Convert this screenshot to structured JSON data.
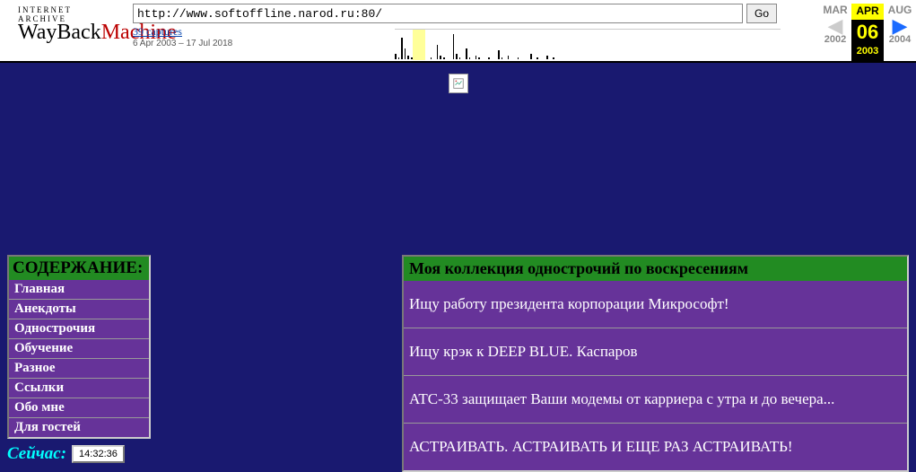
{
  "wayback": {
    "logo_line1": "INTERNET ARCHIVE",
    "logo_word1": "WayBack",
    "logo_word2": "Machine",
    "url": "http://www.softoffline.narod.ru:80/",
    "go_label": "Go",
    "captures_link": "39 captures",
    "captures_range": "6 Apr 2003 – 17 Jul 2018",
    "nav": {
      "prev_month": "MAR",
      "prev_year": "2002",
      "cur_month": "APR",
      "cur_day": "06",
      "cur_year": "2003",
      "next_month": "AUG",
      "next_year": "2004"
    }
  },
  "sidebar": {
    "title": "СОДЕРЖАНИЕ:",
    "items": [
      "Главная",
      "Анекдоты",
      "Однострочия",
      "Обучение",
      "Разное",
      "Ссылки",
      "Обо мне",
      "Для гостей"
    ]
  },
  "clock": {
    "label": "Сейчас:",
    "time": "14:32:36"
  },
  "content": {
    "title": "Моя коллекция однострочий по воскресениям",
    "rows": [
      "Ищу работу президента корпорации Микрософт!",
      "Ищу крэк к DEEP BLUE. Каспаров",
      "ATC-33 защищает Ваши модемы от карриера с утра и до вечера...",
      "АСТРАИВАТЬ. АСТРАИВАТЬ И ЕЩЕ РАЗ АСТРАИВАТЬ!"
    ]
  },
  "sparkline": [
    3,
    1,
    12,
    6,
    2,
    1,
    1,
    0,
    4,
    1,
    0,
    1,
    0,
    8,
    2,
    1,
    0,
    0,
    14,
    3,
    1,
    0,
    6,
    1,
    0,
    2,
    1,
    0,
    0,
    1,
    0,
    0,
    5,
    1,
    0,
    2,
    0,
    0,
    1,
    0,
    0,
    0,
    3,
    0,
    1,
    0,
    0,
    2,
    0,
    1,
    0,
    0,
    0,
    0,
    0,
    0,
    0,
    0,
    0,
    0,
    0,
    0,
    0,
    0,
    0,
    0,
    0,
    0,
    0,
    0,
    0,
    0,
    0,
    0,
    0,
    0,
    0,
    0,
    0,
    0,
    0,
    0,
    0,
    0,
    0,
    0,
    0,
    0,
    0,
    0,
    0,
    0,
    0,
    0,
    0,
    0,
    0,
    0,
    0,
    0,
    0,
    0,
    0,
    0,
    0,
    0,
    0,
    0,
    0,
    0,
    0,
    0,
    0,
    0,
    0,
    0,
    0,
    0,
    0,
    0
  ]
}
